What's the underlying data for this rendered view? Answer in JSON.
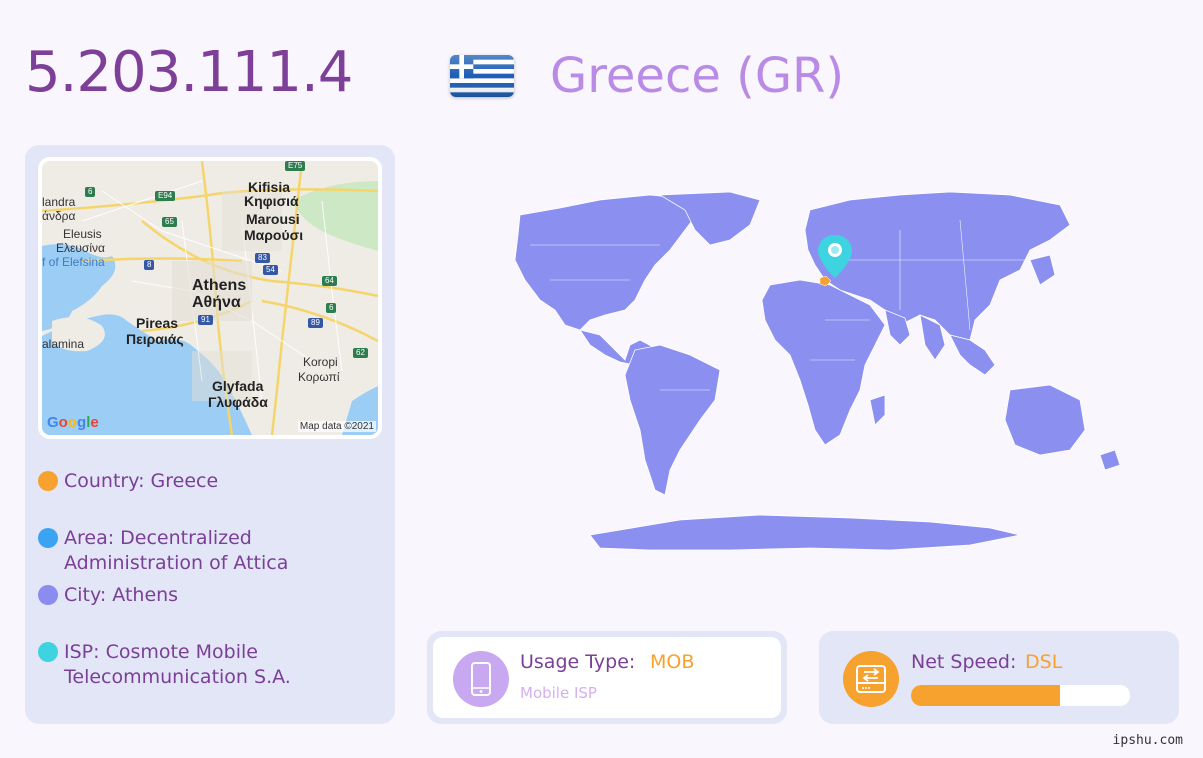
{
  "header": {
    "ip": "5.203.111.4",
    "country_title": "Greece (GR)",
    "flag_icon": "greece-flag"
  },
  "map": {
    "labels": {
      "kifisia": "Kifisia",
      "kifisia_gr": "Κηφισιά",
      "marousi": "Marousi",
      "marousi_gr": "Μαρούσι",
      "andra": "landra",
      "andra_gr": "άνδρα",
      "eleusis": "Eleusis",
      "eleusis_gr": "Ελευσίνα",
      "gulf": "f of Elefsina",
      "athens": "Athens",
      "athens_gr": "Αθήνα",
      "pireas": "Pireas",
      "pireas_gr": "Πειραιάς",
      "salamina": "alamina",
      "koropi": "Koropi",
      "koropi_gr": "Κορωπί",
      "glyfada": "Glyfada",
      "glyfada_gr": "Γλυφάδα"
    },
    "roads": {
      "e75": "E75",
      "r6a": "6",
      "e94": "E94",
      "r65": "65",
      "r8": "8",
      "r83": "83",
      "r54": "54",
      "r64": "64",
      "r6b": "6",
      "r91": "91",
      "r89": "89",
      "r62": "62"
    },
    "google": "Google",
    "credit": "Map data ©2021"
  },
  "info": {
    "country": "Country: Greece",
    "area": "Area: Decentralized Administration of Attica",
    "city": "City: Athens",
    "isp": "ISP: Cosmote Mobile Telecommunication S.A."
  },
  "colors": {
    "country_dot": "#f7a12e",
    "area_dot": "#3aa3f2",
    "city_dot": "#8a8cf0",
    "isp_dot": "#3dd3e0",
    "land": "#8a8ff0",
    "accent": "#f7a12e"
  },
  "usage": {
    "label": "Usage Type:",
    "value": "MOB",
    "sub": "Mobile ISP",
    "icon": "mobile-phone-icon"
  },
  "speed": {
    "label": "Net Speed:",
    "value": "DSL",
    "level_percent": 68,
    "icon": "network-drive-icon"
  },
  "footer": {
    "site": "ipshu.com"
  }
}
